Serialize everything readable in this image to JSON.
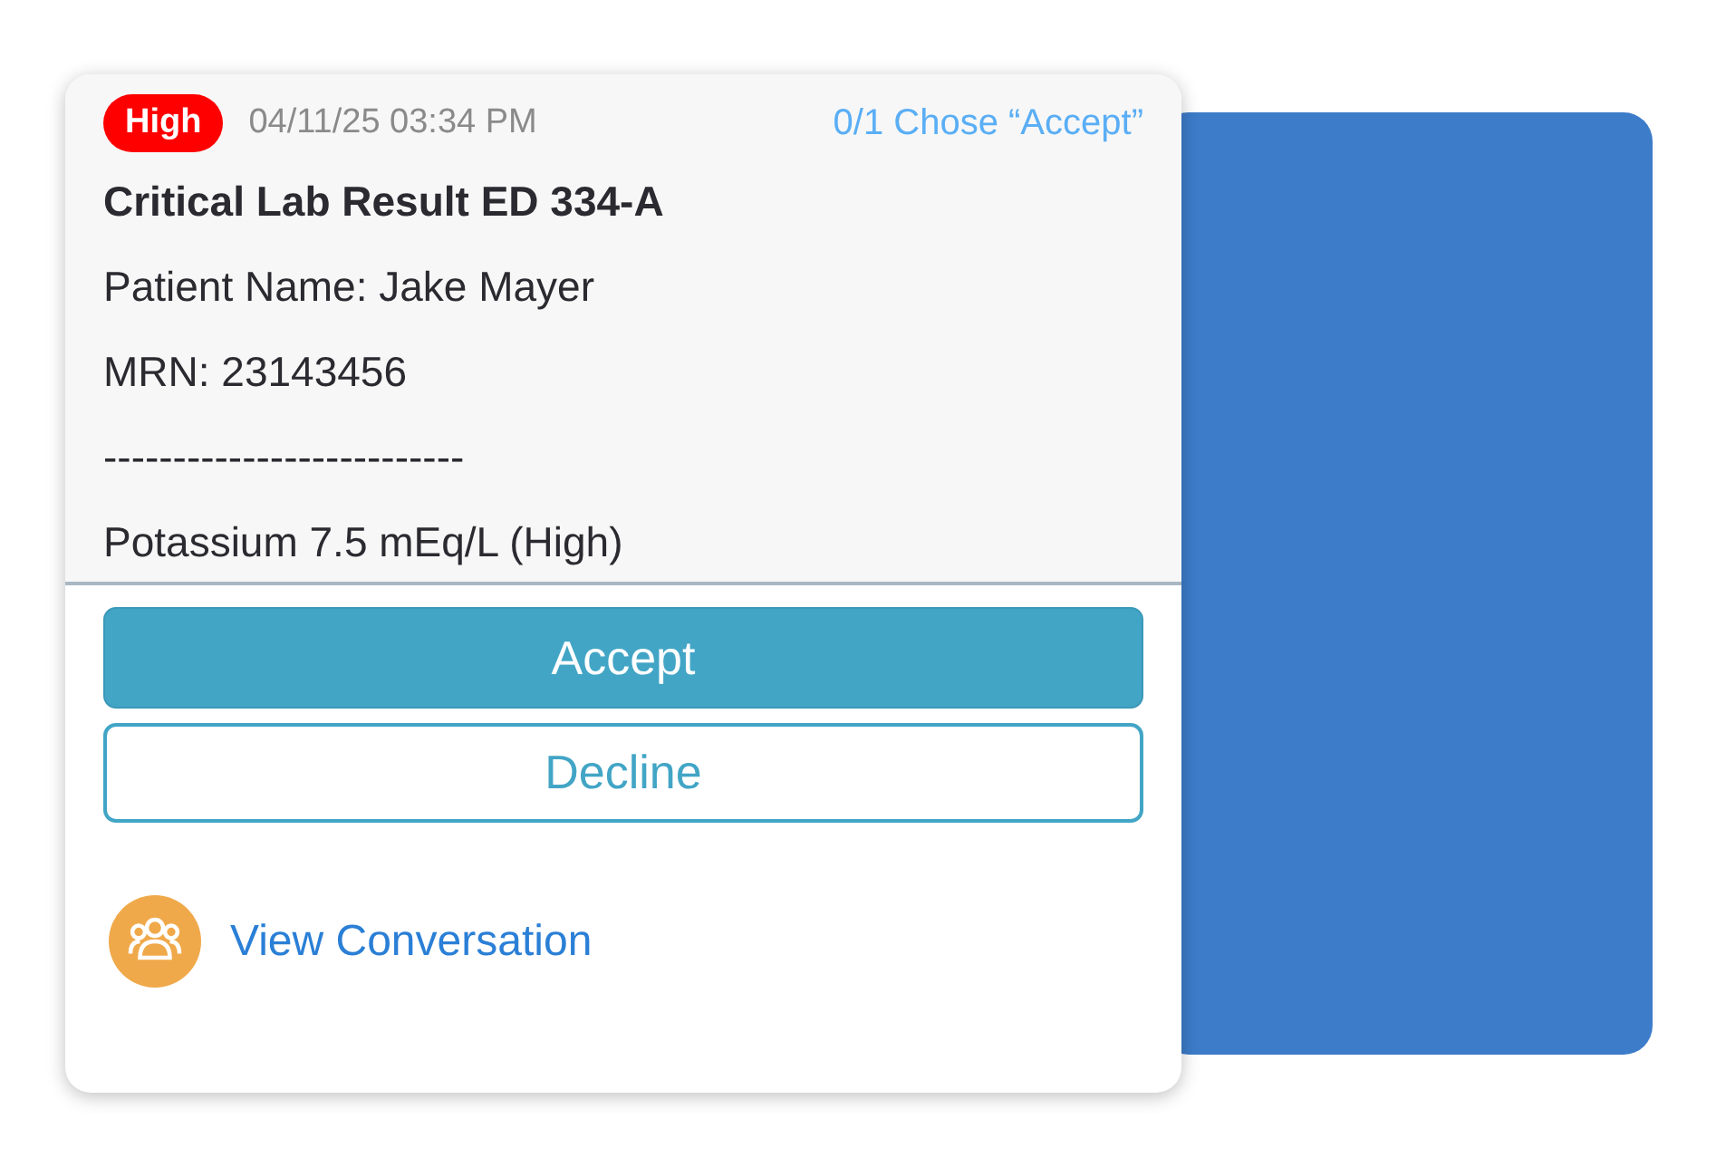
{
  "alert": {
    "priority": "High",
    "timestamp": "04/11/25 03:34 PM",
    "response_status": "0/1 Chose “Accept”",
    "title": "Critical Lab Result ED 334-A",
    "lines": [
      "Patient Name: Jake Mayer",
      "MRN: 23143456",
      "--------------------------",
      "Potassium 7.5 mEq/L (High)"
    ],
    "buttons": [
      {
        "label": "Accept",
        "kind": "primary"
      },
      {
        "label": "Decline",
        "kind": "secondary"
      }
    ],
    "link": "View Conversation"
  }
}
